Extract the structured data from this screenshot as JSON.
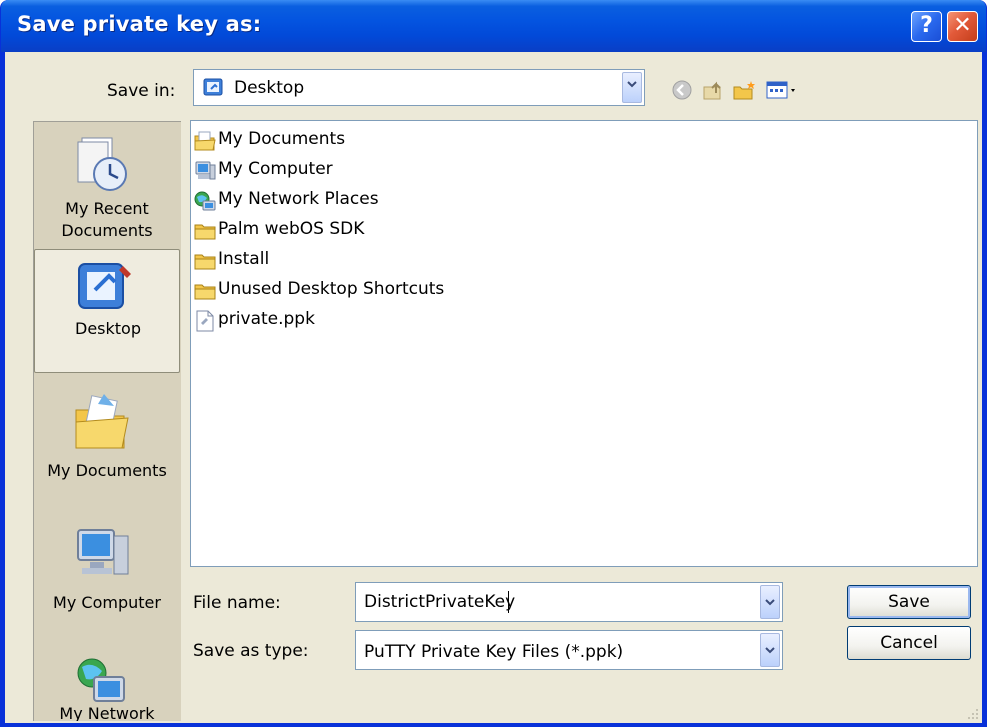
{
  "window": {
    "title": "Save private key as:",
    "help_button": "?",
    "close_button": "✕"
  },
  "toolbar": {
    "save_in_label": "Save in:",
    "save_in_value": "Desktop",
    "icons": [
      "back-icon",
      "up-folder-icon",
      "new-folder-icon",
      "view-menu-icon"
    ]
  },
  "places": [
    {
      "label": "My Recent Documents",
      "icon": "recent-documents-icon"
    },
    {
      "label": "Desktop",
      "icon": "desktop-icon",
      "selected": true
    },
    {
      "label": "My Documents",
      "icon": "my-documents-icon"
    },
    {
      "label": "My Computer",
      "icon": "my-computer-icon"
    },
    {
      "label": "My Network",
      "icon": "my-network-icon"
    }
  ],
  "files": [
    {
      "name": "My Documents",
      "icon": "my-documents-icon"
    },
    {
      "name": "My Computer",
      "icon": "my-computer-icon"
    },
    {
      "name": "My Network Places",
      "icon": "network-places-icon"
    },
    {
      "name": "Palm webOS SDK",
      "icon": "folder-icon"
    },
    {
      "name": "Install",
      "icon": "folder-icon"
    },
    {
      "name": "Unused Desktop Shortcuts",
      "icon": "folder-icon"
    },
    {
      "name": "private.ppk",
      "icon": "file-icon"
    }
  ],
  "form": {
    "file_name_label": "File name:",
    "file_name_value": "DistrictPrivateKey",
    "save_as_type_label": "Save as type:",
    "save_as_type_value": "PuTTY Private Key Files (*.ppk)"
  },
  "buttons": {
    "save": "Save",
    "cancel": "Cancel"
  },
  "colors": {
    "titlebar": "#0454e0",
    "client_bg": "#ece9d8",
    "places_bg": "#d8d2bd",
    "folder": "#f3c64a"
  }
}
